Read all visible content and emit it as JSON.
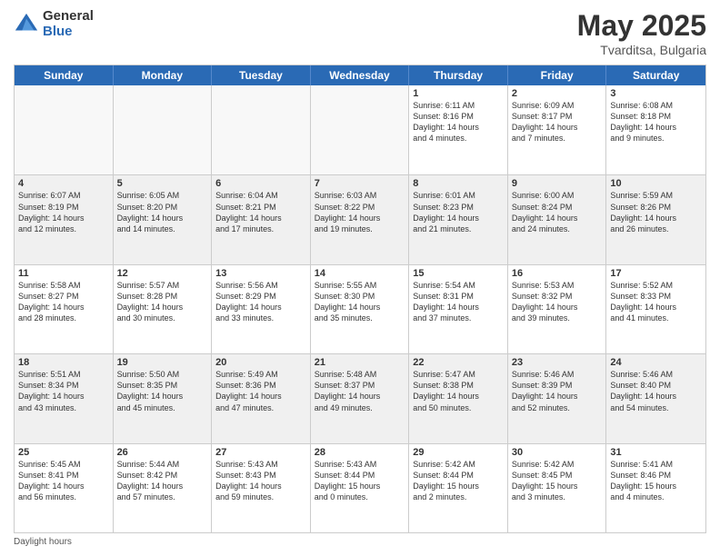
{
  "logo": {
    "general": "General",
    "blue": "Blue"
  },
  "title": {
    "month": "May 2025",
    "location": "Tvarditsa, Bulgaria"
  },
  "header_days": [
    "Sunday",
    "Monday",
    "Tuesday",
    "Wednesday",
    "Thursday",
    "Friday",
    "Saturday"
  ],
  "weeks": [
    [
      {
        "day": "",
        "info": ""
      },
      {
        "day": "",
        "info": ""
      },
      {
        "day": "",
        "info": ""
      },
      {
        "day": "",
        "info": ""
      },
      {
        "day": "1",
        "info": "Sunrise: 6:11 AM\nSunset: 8:16 PM\nDaylight: 14 hours\nand 4 minutes."
      },
      {
        "day": "2",
        "info": "Sunrise: 6:09 AM\nSunset: 8:17 PM\nDaylight: 14 hours\nand 7 minutes."
      },
      {
        "day": "3",
        "info": "Sunrise: 6:08 AM\nSunset: 8:18 PM\nDaylight: 14 hours\nand 9 minutes."
      }
    ],
    [
      {
        "day": "4",
        "info": "Sunrise: 6:07 AM\nSunset: 8:19 PM\nDaylight: 14 hours\nand 12 minutes."
      },
      {
        "day": "5",
        "info": "Sunrise: 6:05 AM\nSunset: 8:20 PM\nDaylight: 14 hours\nand 14 minutes."
      },
      {
        "day": "6",
        "info": "Sunrise: 6:04 AM\nSunset: 8:21 PM\nDaylight: 14 hours\nand 17 minutes."
      },
      {
        "day": "7",
        "info": "Sunrise: 6:03 AM\nSunset: 8:22 PM\nDaylight: 14 hours\nand 19 minutes."
      },
      {
        "day": "8",
        "info": "Sunrise: 6:01 AM\nSunset: 8:23 PM\nDaylight: 14 hours\nand 21 minutes."
      },
      {
        "day": "9",
        "info": "Sunrise: 6:00 AM\nSunset: 8:24 PM\nDaylight: 14 hours\nand 24 minutes."
      },
      {
        "day": "10",
        "info": "Sunrise: 5:59 AM\nSunset: 8:26 PM\nDaylight: 14 hours\nand 26 minutes."
      }
    ],
    [
      {
        "day": "11",
        "info": "Sunrise: 5:58 AM\nSunset: 8:27 PM\nDaylight: 14 hours\nand 28 minutes."
      },
      {
        "day": "12",
        "info": "Sunrise: 5:57 AM\nSunset: 8:28 PM\nDaylight: 14 hours\nand 30 minutes."
      },
      {
        "day": "13",
        "info": "Sunrise: 5:56 AM\nSunset: 8:29 PM\nDaylight: 14 hours\nand 33 minutes."
      },
      {
        "day": "14",
        "info": "Sunrise: 5:55 AM\nSunset: 8:30 PM\nDaylight: 14 hours\nand 35 minutes."
      },
      {
        "day": "15",
        "info": "Sunrise: 5:54 AM\nSunset: 8:31 PM\nDaylight: 14 hours\nand 37 minutes."
      },
      {
        "day": "16",
        "info": "Sunrise: 5:53 AM\nSunset: 8:32 PM\nDaylight: 14 hours\nand 39 minutes."
      },
      {
        "day": "17",
        "info": "Sunrise: 5:52 AM\nSunset: 8:33 PM\nDaylight: 14 hours\nand 41 minutes."
      }
    ],
    [
      {
        "day": "18",
        "info": "Sunrise: 5:51 AM\nSunset: 8:34 PM\nDaylight: 14 hours\nand 43 minutes."
      },
      {
        "day": "19",
        "info": "Sunrise: 5:50 AM\nSunset: 8:35 PM\nDaylight: 14 hours\nand 45 minutes."
      },
      {
        "day": "20",
        "info": "Sunrise: 5:49 AM\nSunset: 8:36 PM\nDaylight: 14 hours\nand 47 minutes."
      },
      {
        "day": "21",
        "info": "Sunrise: 5:48 AM\nSunset: 8:37 PM\nDaylight: 14 hours\nand 49 minutes."
      },
      {
        "day": "22",
        "info": "Sunrise: 5:47 AM\nSunset: 8:38 PM\nDaylight: 14 hours\nand 50 minutes."
      },
      {
        "day": "23",
        "info": "Sunrise: 5:46 AM\nSunset: 8:39 PM\nDaylight: 14 hours\nand 52 minutes."
      },
      {
        "day": "24",
        "info": "Sunrise: 5:46 AM\nSunset: 8:40 PM\nDaylight: 14 hours\nand 54 minutes."
      }
    ],
    [
      {
        "day": "25",
        "info": "Sunrise: 5:45 AM\nSunset: 8:41 PM\nDaylight: 14 hours\nand 56 minutes."
      },
      {
        "day": "26",
        "info": "Sunrise: 5:44 AM\nSunset: 8:42 PM\nDaylight: 14 hours\nand 57 minutes."
      },
      {
        "day": "27",
        "info": "Sunrise: 5:43 AM\nSunset: 8:43 PM\nDaylight: 14 hours\nand 59 minutes."
      },
      {
        "day": "28",
        "info": "Sunrise: 5:43 AM\nSunset: 8:44 PM\nDaylight: 15 hours\nand 0 minutes."
      },
      {
        "day": "29",
        "info": "Sunrise: 5:42 AM\nSunset: 8:44 PM\nDaylight: 15 hours\nand 2 minutes."
      },
      {
        "day": "30",
        "info": "Sunrise: 5:42 AM\nSunset: 8:45 PM\nDaylight: 15 hours\nand 3 minutes."
      },
      {
        "day": "31",
        "info": "Sunrise: 5:41 AM\nSunset: 8:46 PM\nDaylight: 15 hours\nand 4 minutes."
      }
    ]
  ],
  "footer": "Daylight hours"
}
